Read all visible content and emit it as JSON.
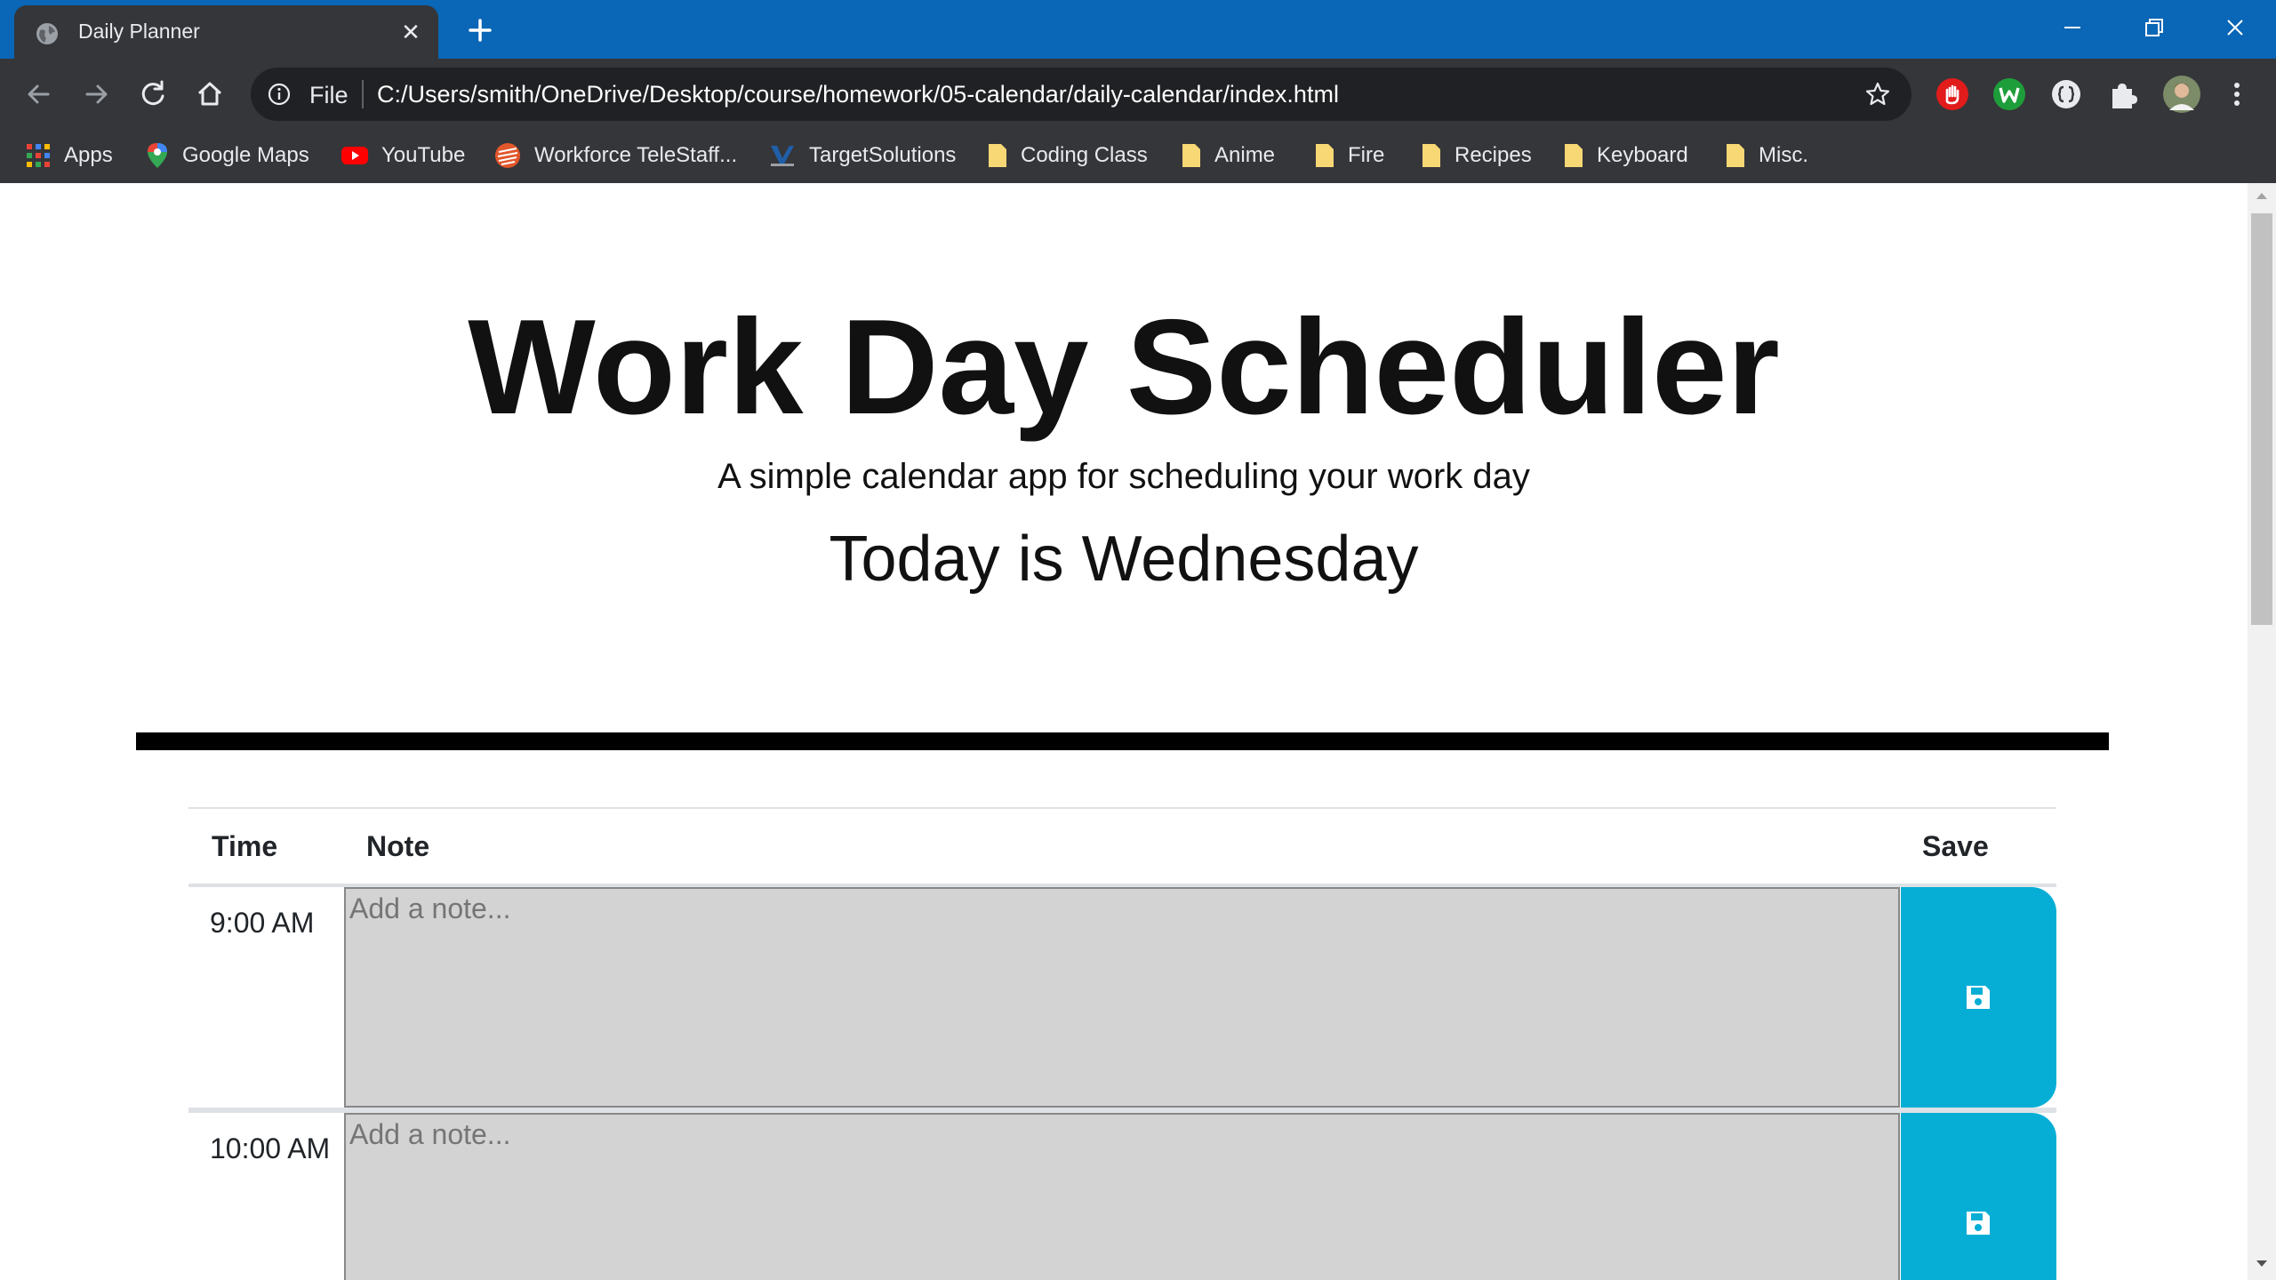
{
  "browser": {
    "tab_title": "Daily Planner",
    "omnibox": {
      "scheme": "File",
      "url": "C:/Users/smith/OneDrive/Desktop/course/homework/05-calendar/daily-calendar/index.html"
    },
    "bookmarks": [
      {
        "label": "Apps",
        "icon": "apps-grid-icon"
      },
      {
        "label": "Google Maps",
        "icon": "google-maps-icon"
      },
      {
        "label": "YouTube",
        "icon": "youtube-icon"
      },
      {
        "label": "Workforce TeleStaff...",
        "icon": "telestaff-icon"
      },
      {
        "label": "TargetSolutions",
        "icon": "targetsolutions-icon"
      },
      {
        "label": "Coding Class",
        "icon": "folder-icon"
      },
      {
        "label": "Anime",
        "icon": "folder-icon"
      },
      {
        "label": "Fire",
        "icon": "folder-icon"
      },
      {
        "label": "Recipes",
        "icon": "folder-icon"
      },
      {
        "label": "Keyboard",
        "icon": "folder-icon"
      },
      {
        "label": "Misc.",
        "icon": "folder-icon"
      }
    ]
  },
  "header": {
    "title": "Work Day Scheduler",
    "lead": "A simple calendar app for scheduling your work day",
    "today": "Today is Wednesday"
  },
  "table": {
    "headers": {
      "time": "Time",
      "note": "Note",
      "save": "Save"
    },
    "rows": [
      {
        "time": "9:00 AM",
        "placeholder": "Add a note...",
        "value": ""
      },
      {
        "time": "10:00 AM",
        "placeholder": "Add a note...",
        "value": ""
      }
    ]
  },
  "colors": {
    "tabbar": "#0a66b6",
    "chrome": "#35363a",
    "note_bg": "#d3d3d3",
    "save_bg": "#06aed5"
  }
}
